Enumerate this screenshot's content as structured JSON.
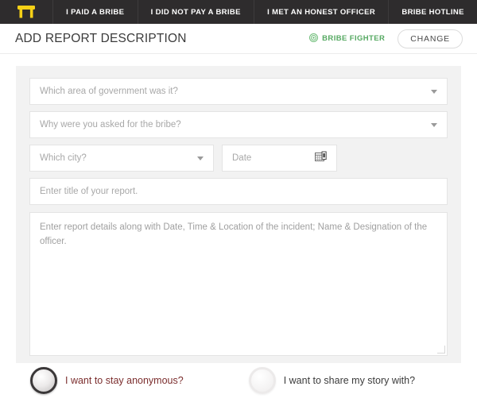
{
  "navbar": {
    "logo_icon": "table-logo-icon",
    "items": [
      {
        "label": "I PAID A BRIBE"
      },
      {
        "label": "I DID NOT PAY A BRIBE"
      },
      {
        "label": "I MET AN HONEST OFFICER"
      },
      {
        "label": "BRIBE HOTLINE"
      }
    ]
  },
  "header": {
    "title": "ADD REPORT DESCRIPTION",
    "badge_label": "BRIBE FIGHTER",
    "badge_icon": "target-circle-icon",
    "badge_color": "#56a962",
    "change_label": "CHANGE"
  },
  "form": {
    "area_of_government": {
      "placeholder": "Which area of government was it?",
      "value": ""
    },
    "reason": {
      "placeholder": "Why were you asked for the bribe?",
      "value": ""
    },
    "city": {
      "placeholder": "Which city?",
      "value": ""
    },
    "date": {
      "placeholder": "Date",
      "value": "",
      "icon": "calendar-icon"
    },
    "report_title": {
      "placeholder": "Enter title of your report.",
      "value": ""
    },
    "report_details": {
      "placeholder": "Enter report details along with Date, Time & Location of the incident; Name & Designation of the officer.",
      "value": ""
    }
  },
  "options": {
    "anonymous": {
      "label": "I want to stay anonymous?",
      "selected": true
    },
    "share": {
      "label": "I want to share my story with?",
      "selected": false
    }
  },
  "colors": {
    "navbar_bg": "#2e2c2d",
    "logo_yellow": "#f5d016",
    "panel_bg": "#f2f2f2",
    "accent_red": "#7b2d2d"
  }
}
